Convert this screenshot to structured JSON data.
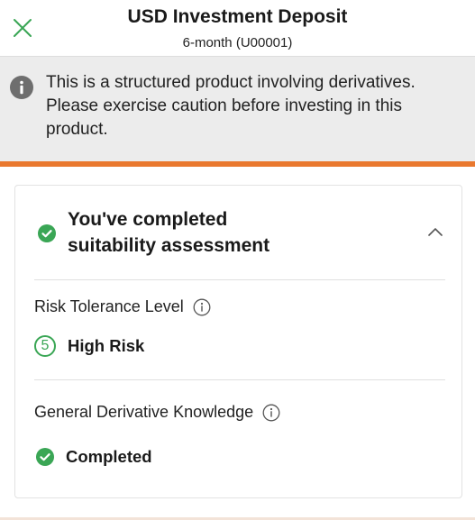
{
  "header": {
    "title": "USD Investment Deposit",
    "subtitle": "6-month (U00001)"
  },
  "notice": {
    "text": "This is a structured product involving derivatives. Please exercise caution before investing in this product."
  },
  "suitability": {
    "title_line1": "You've completed",
    "title_line2": "suitability assessment",
    "risk_label": "Risk Tolerance Level",
    "risk_level_number": "5",
    "risk_level_text": "High Risk",
    "knowledge_label": "General Derivative Knowledge",
    "knowledge_status": "Completed"
  },
  "icons": {
    "close": "close-x-icon",
    "notice": "info-filled-icon",
    "check": "check-circle-icon",
    "chevron": "chevron-up-icon",
    "info_outline": "info-outline-icon"
  },
  "colors": {
    "brand_green": "#3aa655",
    "accent_orange": "#e9782e",
    "notice_bg": "#ececec",
    "notice_icon": "#6e6e6e"
  }
}
